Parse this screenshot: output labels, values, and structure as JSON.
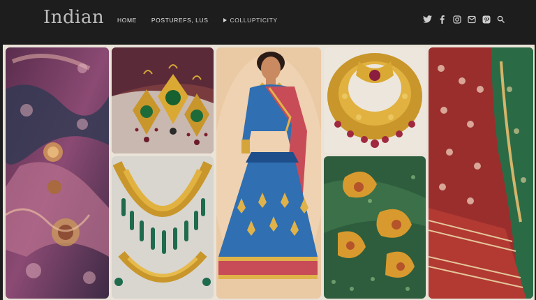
{
  "brand": {
    "logo_text": "Indian"
  },
  "nav": {
    "items": [
      {
        "label": "HOME"
      },
      {
        "label": "POSTUREFS, LUS"
      },
      {
        "label": "COLLUPTICITY"
      }
    ]
  },
  "social": {
    "icons": [
      "twitter-icon",
      "facebook-icon",
      "instagram-icon",
      "mail-icon",
      "pinterest-icon",
      "search-icon"
    ]
  },
  "colors": {
    "header_bg": "#1d1d1d",
    "gallery_bg": "#e9e3d8",
    "gold": "#c89a2a",
    "saree_blue": "#2f6fb2",
    "maroon": "#8e2a2f",
    "green": "#2a6b46"
  },
  "gallery": {
    "tiles": [
      {
        "name": "purple-floral-fabric"
      },
      {
        "name": "gold-earrings-green-stones"
      },
      {
        "name": "woman-blue-saree-illustration"
      },
      {
        "name": "gold-necklace-pendant"
      },
      {
        "name": "red-green-saree-fabric"
      },
      {
        "name": "gold-green-bead-necklaces"
      },
      {
        "name": "green-gold-paisley-fabric"
      }
    ]
  }
}
